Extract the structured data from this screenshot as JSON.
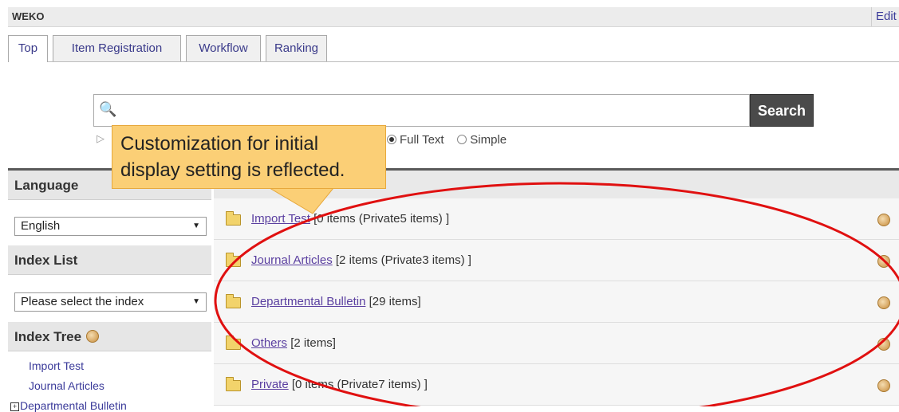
{
  "header": {
    "site_name": "WEKO",
    "edit_label": "Edit"
  },
  "tabs": [
    {
      "label": "Top",
      "active": true
    },
    {
      "label": "Item Registration",
      "active": false
    },
    {
      "label": "Workflow",
      "active": false
    },
    {
      "label": "Ranking",
      "active": false
    }
  ],
  "search": {
    "button_label": "Search",
    "value": "",
    "options": [
      {
        "label": "Full Text",
        "checked": true
      },
      {
        "label": "Simple",
        "checked": false
      }
    ]
  },
  "callout": {
    "line1": "Customization for initial",
    "line2": "display setting is reflected."
  },
  "sidebar": {
    "language_title": "Language",
    "language_selected": "English",
    "index_list_title": "Index List",
    "index_list_selected": "Please select the index",
    "index_tree_title": "Index Tree",
    "tree_items": [
      "Import Test",
      "Journal Articles",
      "Departmental Bulletin"
    ]
  },
  "index_rows": [
    {
      "name": "Import Test",
      "count": "[0 items (Private5 items) ]"
    },
    {
      "name": "Journal Articles",
      "count": "[2 items (Private3 items) ]"
    },
    {
      "name": "Departmental Bulletin",
      "count": "[29 items]"
    },
    {
      "name": "Others",
      "count": "[2 items]"
    },
    {
      "name": "Private",
      "count": "[0 items (Private7 items) ]"
    }
  ],
  "colors": {
    "annotation_red": "#e01010",
    "callout_fill": "#fbcf76",
    "search_button": "#4a4a4a"
  }
}
